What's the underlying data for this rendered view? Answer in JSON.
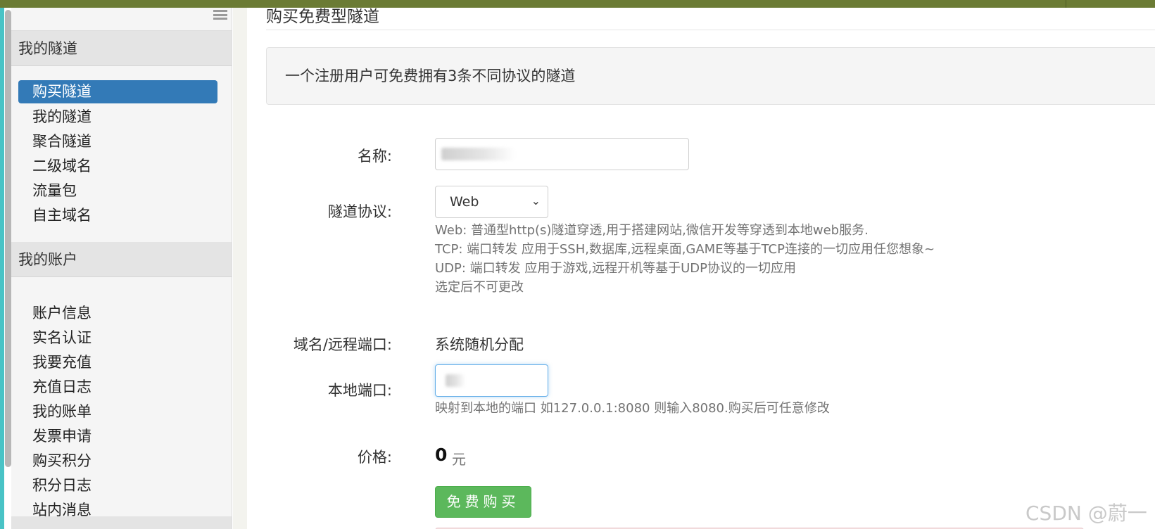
{
  "sidebar": {
    "my_tunnels_header": "我的隧道",
    "tunnel_items": [
      {
        "label": "购买隧道",
        "active": true
      },
      {
        "label": "我的隧道"
      },
      {
        "label": "聚合隧道"
      },
      {
        "label": "二级域名"
      },
      {
        "label": "流量包"
      },
      {
        "label": "自主域名"
      }
    ],
    "my_account_header": "我的账户",
    "account_items": [
      {
        "label": "账户信息"
      },
      {
        "label": "实名认证"
      },
      {
        "label": "我要充值"
      },
      {
        "label": "充值日志"
      },
      {
        "label": "我的账单"
      },
      {
        "label": "发票申请"
      },
      {
        "label": "购买积分"
      },
      {
        "label": "积分日志"
      },
      {
        "label": "站内消息"
      }
    ]
  },
  "main": {
    "page_title": "购买免费型隧道",
    "notice": "一个注册用户可免费拥有3条不同协议的隧道",
    "form": {
      "name_label": "名称:",
      "protocol_label": "隧道协议:",
      "protocol_selected": "Web",
      "protocol_help": [
        "Web: 普通型http(s)隧道穿透,用于搭建网站,微信开发等穿透到本地web服务.",
        "TCP: 端口转发 应用于SSH,数据库,远程桌面,GAME等基于TCP连接的一切应用任您想象~",
        "UDP: 端口转发 应用于游戏,远程开机等基于UDP协议的一切应用",
        "选定后不可更改"
      ],
      "domain_label": "域名/远程端口:",
      "domain_value": "系统随机分配",
      "local_port_label": "本地端口:",
      "local_port_help": "映射到本地的端口 如127.0.0.1:8080 则输入8080.购买后可任意修改",
      "price_label": "价格:",
      "price_value": "0",
      "price_unit": "元",
      "buy_button": "免费购买"
    }
  },
  "watermark": "CSDN @蔚一",
  "colors": {
    "topbar": "#6b7b34",
    "active_nav": "#337ab7",
    "buy_button": "#5cb85c",
    "left_accent": "#49c3c6"
  },
  "icons": {
    "sidebar_toggle": "menu-icon",
    "select_arrow": "chevron-down-icon"
  }
}
